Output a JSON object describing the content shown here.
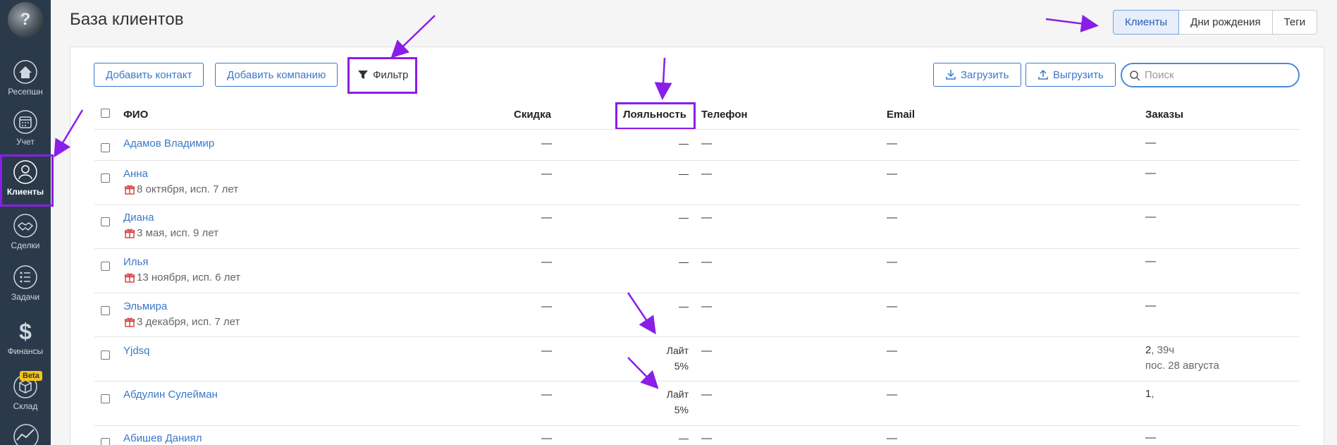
{
  "sidebar": {
    "items": [
      {
        "label": "Ресепшн",
        "icon": "house-icon"
      },
      {
        "label": "Учет",
        "icon": "calendar-icon"
      },
      {
        "label": "Клиенты",
        "icon": "person-icon"
      },
      {
        "label": "Сделки",
        "icon": "handshake-icon"
      },
      {
        "label": "Задачи",
        "icon": "tasks-icon"
      },
      {
        "label": "Финансы",
        "icon": "dollar-icon"
      },
      {
        "label": "Склад",
        "icon": "box-icon"
      }
    ],
    "beta_badge": "Beta"
  },
  "header": {
    "title": "База клиентов",
    "tabs": [
      "Клиенты",
      "Дни рождения",
      "Теги"
    ],
    "active_tab": "Клиенты"
  },
  "toolbar": {
    "add_contact": "Добавить контакт",
    "add_company": "Добавить компанию",
    "filter": "Фильтр",
    "upload": "Загрузить",
    "download": "Выгрузить",
    "search_placeholder": "Поиск"
  },
  "table": {
    "columns": [
      "ФИО",
      "Скидка",
      "Лояльность",
      "Телефон",
      "Email",
      "Заказы"
    ],
    "rows": [
      {
        "name": "Адамов Владимир",
        "birthday": "",
        "discount": "—",
        "loyalty": "—",
        "loyalty_pct": "",
        "phone": "—",
        "email": "—",
        "orders": "—",
        "orders_extra": "",
        "orders_last": ""
      },
      {
        "name": "Анна",
        "birthday": "8 октября, исп. 7 лет",
        "discount": "—",
        "loyalty": "—",
        "loyalty_pct": "",
        "phone": "—",
        "email": "—",
        "orders": "—",
        "orders_extra": "",
        "orders_last": ""
      },
      {
        "name": "Диана",
        "birthday": "3 мая, исп. 9 лет",
        "discount": "—",
        "loyalty": "—",
        "loyalty_pct": "",
        "phone": "—",
        "email": "—",
        "orders": "—",
        "orders_extra": "",
        "orders_last": ""
      },
      {
        "name": "Илья",
        "birthday": "13 ноября, исп. 6 лет",
        "discount": "—",
        "loyalty": "—",
        "loyalty_pct": "",
        "phone": "—",
        "email": "—",
        "orders": "—",
        "orders_extra": "",
        "orders_last": ""
      },
      {
        "name": "Эльмира",
        "birthday": "3 декабря, исп. 7 лет",
        "discount": "—",
        "loyalty": "—",
        "loyalty_pct": "",
        "phone": "—",
        "email": "—",
        "orders": "—",
        "orders_extra": "",
        "orders_last": ""
      },
      {
        "name": "Yjdsq",
        "birthday": "",
        "discount": "—",
        "loyalty": "Лайт",
        "loyalty_pct": "5%",
        "phone": "—",
        "email": "—",
        "orders": "2",
        "orders_extra": ", 39ч",
        "orders_last": "пос. 28 августа"
      },
      {
        "name": "Абдулин Сулейман",
        "birthday": "",
        "discount": "—",
        "loyalty": "Лайт",
        "loyalty_pct": "5%",
        "phone": "—",
        "email": "—",
        "orders": "1",
        "orders_extra": ",",
        "orders_last": ""
      },
      {
        "name": "Абишев Даниял",
        "birthday": "",
        "discount": "—",
        "loyalty": "—",
        "loyalty_pct": "",
        "phone": "—",
        "email": "—",
        "orders": "—",
        "orders_extra": "",
        "orders_last": ""
      }
    ]
  },
  "colors": {
    "sidebar_bg": "#2b3a4a",
    "accent": "#3a78c9",
    "annotation": "#8a1ee8",
    "gift": "#d23c3c"
  }
}
